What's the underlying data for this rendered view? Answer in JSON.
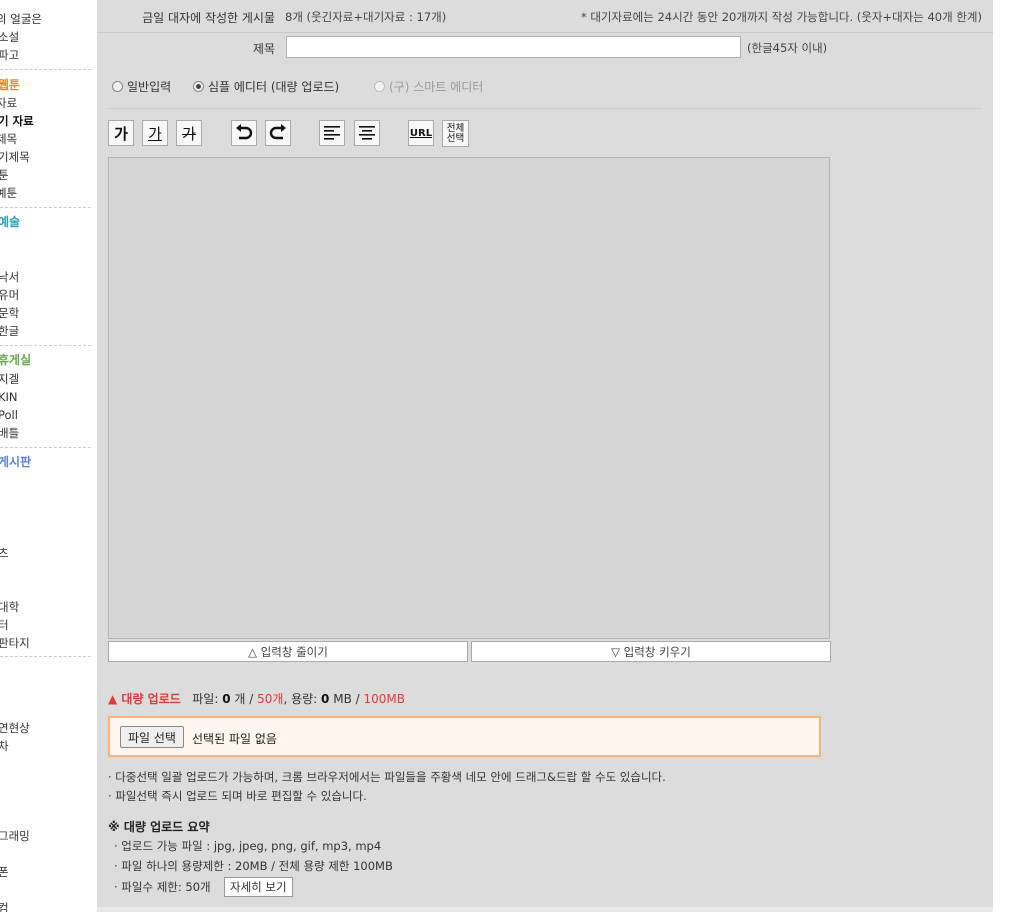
{
  "sidebar": {
    "group1": [
      "의 얼굴은",
      "소설",
      "파고"
    ],
    "group2_head": "웹툰",
    "group2": [
      "자료",
      "기 자료",
      "제목",
      "기제목",
      "툰",
      "예툰"
    ],
    "group3_head": "예술",
    "group3": [
      "",
      "",
      "낙서",
      "유머",
      "문학",
      "한글"
    ],
    "group4_head": "휴게실",
    "group4": [
      "지겔",
      "KIN",
      "Poll",
      "배틀"
    ],
    "group5_head": "게시판",
    "group5": [
      "",
      "",
      "",
      "",
      "츠",
      "",
      "",
      "대학",
      "터",
      "판타지"
    ],
    "group6": [
      "",
      "",
      "",
      "연현상",
      "차",
      "",
      "",
      "",
      "",
      "그래밍",
      "",
      "폰",
      "",
      "컴"
    ]
  },
  "form": {
    "count_label": "금일 대자에 작성한 게시물",
    "count_value": "8개   (웃긴자료+대기자료 : 17개)",
    "count_note": "* 대기자료에는 24시간 동안 20개까지 작성 가능합니다. (웃자+대자는 40개 한계)",
    "title_label": "제목",
    "title_value": "",
    "title_hint": "(한글45자 이내)"
  },
  "editor_modes": {
    "normal": "일반입력",
    "simple": "심플 에디터 (대량 업로드)",
    "smart": "(구) 스마트 에디터",
    "selected": "simple"
  },
  "toolbar": {
    "bold": "가",
    "underline": "가",
    "strike": "가",
    "url": "URL",
    "select_all": "전체선택"
  },
  "resize": {
    "shrink": "△ 입력창 줄이기",
    "grow": "▽ 입력창 키우기"
  },
  "upload": {
    "title": "▲ 대량 업로드",
    "file_label": "파일:",
    "file_count": "0",
    "file_unit": "개 /",
    "file_max": "50개",
    "size_label": ", 용량:",
    "size_used": "0",
    "size_unit": "MB /",
    "size_max": "100MB",
    "choose_button": "파일 선택",
    "choose_status": "선택된 파일 없음",
    "note1": "· 다중선택 일괄 업로드가 가능하며, 크롬 브라우저에서는 파일들을 주황색 네모 안에 드래그&드랍 할 수도 있습니다.",
    "note2": "· 파일선택 즉시 업로드 되며 바로 편집할 수 있습니다."
  },
  "summary": {
    "title": "※ 대량 업로드 요약",
    "allowed": "· 업로드 가능 파일 : jpg, jpeg, png, gif, mp3, mp4",
    "limit": "· 파일 하나의 용량제한 : 20MB / 전체 용량 제한 100MB",
    "count_limit": "· 파일수 제한: 50개",
    "detail_button": "자세히 보기"
  },
  "colors": {
    "panel_bg": "#dcdcdc",
    "accent_red": "#e13a3a",
    "upload_border": "#f6b37b",
    "head_orange": "#e58a1f",
    "head_teal": "#2aa3b8",
    "head_green": "#6aa84f",
    "head_blue": "#5b7fd6"
  }
}
